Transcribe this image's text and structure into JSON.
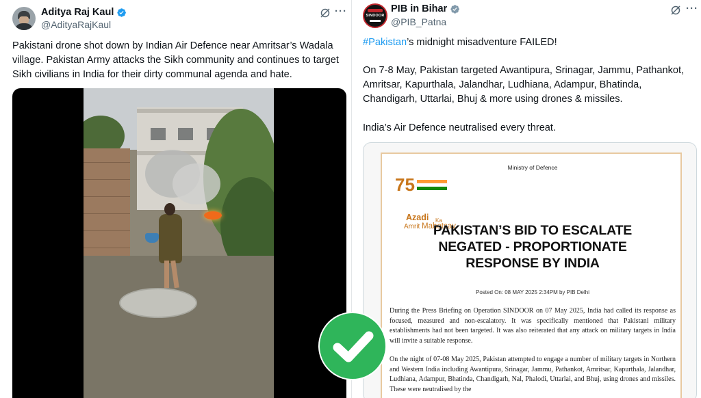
{
  "left_tweet": {
    "author_name": "Aditya Raj Kaul",
    "handle": "@AdityaRajKaul",
    "text": "Pakistani drone shot down by Indian Air Defence near Amritsar’s Wadala village. Pakistan Army attacks the Sikh community and continues to target Sikh civilians in India for their dirty communal agenda and hate.",
    "more_label": "···",
    "verified_icon": "verified-badge-icon",
    "grok_icon": "grok-icon"
  },
  "right_tweet": {
    "author_name": "PIB in Bihar",
    "handle": "@PIB_Patna",
    "avatar_text": "SINDOOR",
    "hashtag": "#Pakistan",
    "line1_rest": "’s midnight misadventure FAILED!",
    "paragraph2": "On 7-8 May, Pakistan targeted Awantipura, Srinagar, Jammu, Pathankot, Amritsar, Kapurthala, Jalandhar, Ludhiana, Adampur, Bhatinda, Chandigarh, Uttarlai, Bhuj & more using drones & missiles.",
    "paragraph3": "India’s Air Defence neutralised every threat.",
    "more_label": "···",
    "document": {
      "ministry": "Ministry of Defence",
      "logo_number": "75",
      "logo_azadi": "Azadi",
      "logo_ka": "Ka",
      "logo_amrit": "Amrit",
      "logo_mahotsav": "Mahotsav",
      "title_line1": "PAKISTAN’S BID TO ESCALATE",
      "title_line2": "NEGATED - PROPORTIONATE",
      "title_line3": "RESPONSE BY INDIA",
      "posted_on": "Posted On: 08 MAY 2025 2:34PM by PIB Delhi",
      "para1": "During the Press Briefing on Operation SINDOOR on 07 May 2025, India had called its response as focused, measured and non-escalatory. It was specifically mentioned that Pakistani military establishments had not been targeted. It was also reiterated that any attack on military targets in India will invite a suitable response.",
      "para2": "On the night of 07-08 May 2025, Pakistan attempted to engage a number of military targets in Northern and Western India including Awantipura, Srinagar, Jammu, Pathankot, Amritsar, Kapurthala, Jalandhar, Ludhiana, Adampur, Bhatinda, Chandigarh, Nal, Phalodi, Uttarlai, and Bhuj, using drones and missiles. These were neutralised by the"
    }
  },
  "overlay": {
    "icon": "green-checkmark-icon",
    "color": "#2fb55a"
  },
  "colors": {
    "link_blue": "#1d9bf0",
    "secondary_text": "#536471",
    "logo_saffron": "#c8761b"
  }
}
